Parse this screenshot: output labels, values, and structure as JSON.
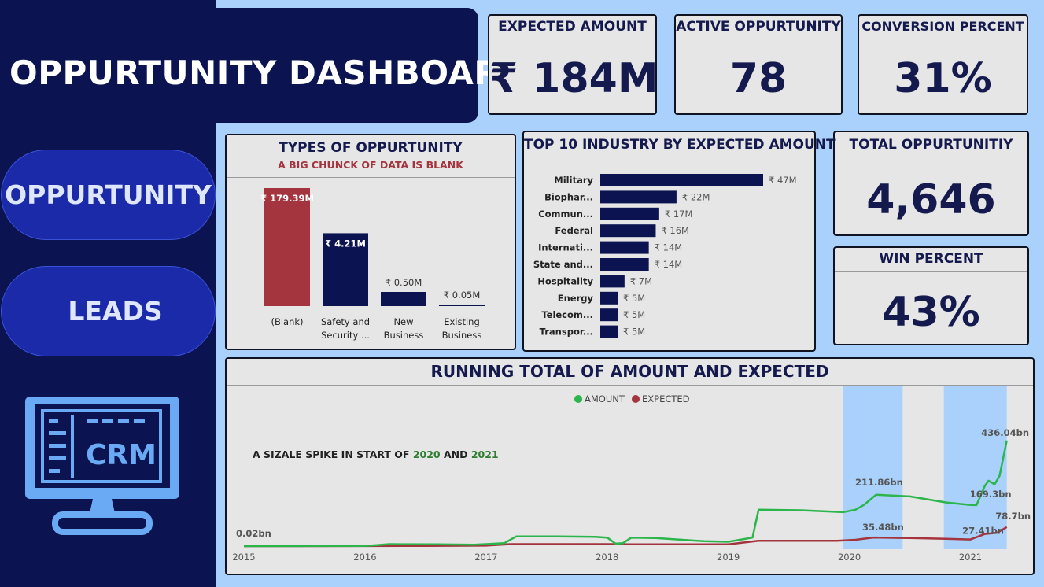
{
  "dashboard_title": "OPPURTUNITY DASHBOARD",
  "nav": {
    "oppurtunity": "OPPURTUNITY",
    "leads": "LEADS"
  },
  "crm_logo_text": "CRM",
  "kpis": {
    "expected_amount": {
      "label": "EXPECTED AMOUNT",
      "value": "₹ 184M"
    },
    "active_oppurtunity": {
      "label": "ACTIVE OPPURTUNITY",
      "value": "78"
    },
    "conversion_percent": {
      "label": "CONVERSION PERCENT",
      "value": "31%"
    },
    "total_oppurtunity": {
      "label": "TOTAL OPPURTUNITIY",
      "value": "4,646"
    },
    "win_percent": {
      "label": "WIN PERCENT",
      "value": "43%"
    }
  },
  "colors": {
    "navy": "#0b1350",
    "red": "#a4353f",
    "green": "#2bb54a",
    "highlight": "#a9d1fb"
  },
  "chart_data": [
    {
      "type": "bar",
      "title": "TYPES OF OPPURTUNITY",
      "subtitle": "A BIG CHUNCK OF DATA IS BLANK",
      "categories": [
        "(Blank)",
        "Safety and Security ...",
        "New Business",
        "Existing Business"
      ],
      "values": [
        179.39,
        4.21,
        0.5,
        0.05
      ],
      "value_labels": [
        "₹ 179.39M",
        "₹ 4.21M",
        "₹ 0.50M",
        "₹ 0.05M"
      ],
      "colors": [
        "#a4353f",
        "#0b1350",
        "#0b1350",
        "#0b1350"
      ]
    },
    {
      "type": "bar",
      "orientation": "horizontal",
      "title": "TOP 10 INDUSTRY BY EXPECTED AMOUNT",
      "categories": [
        "Military",
        "Biophar...",
        "Commun...",
        "Federal",
        "Internati...",
        "State and...",
        "Hospitality",
        "Energy",
        "Telecom...",
        "Transpor..."
      ],
      "values": [
        47,
        22,
        17,
        16,
        14,
        14,
        7,
        5,
        5,
        5
      ],
      "value_labels": [
        "₹ 47M",
        "₹ 22M",
        "₹ 17M",
        "₹ 16M",
        "₹ 14M",
        "₹ 14M",
        "₹ 7M",
        "₹ 5M",
        "₹ 5M",
        "₹ 5M"
      ]
    },
    {
      "type": "line",
      "title": "RUNNING TOTAL OF AMOUNT AND EXPECTED",
      "annotation": {
        "prefix": "A SIZALE SPIKE IN START OF ",
        "year1": "2020",
        "middle": " AND ",
        "year2": "2021"
      },
      "x_ticks": [
        "2015",
        "2016",
        "2017",
        "2018",
        "2019",
        "2020",
        "2021"
      ],
      "x_range": [
        2015,
        2021.38
      ],
      "y_range": [
        0,
        520
      ],
      "highlight_ranges": [
        [
          2019.95,
          2020.44
        ],
        [
          2020.78,
          2021.3
        ]
      ],
      "series": [
        {
          "name": "AMOUNT",
          "color": "#2bb54a",
          "points": [
            [
              2015,
              0.02
            ],
            [
              2016,
              0.5
            ],
            [
              2016.1,
              4
            ],
            [
              2016.2,
              8
            ],
            [
              2016.6,
              7
            ],
            [
              2016.9,
              6
            ],
            [
              2017.0,
              8
            ],
            [
              2017.15,
              12
            ],
            [
              2017.25,
              40
            ],
            [
              2017.6,
              40
            ],
            [
              2017.9,
              38
            ],
            [
              2018.0,
              35
            ],
            [
              2018.07,
              10
            ],
            [
              2018.13,
              12
            ],
            [
              2018.2,
              35
            ],
            [
              2018.4,
              33
            ],
            [
              2018.8,
              20
            ],
            [
              2019.0,
              18
            ],
            [
              2019.2,
              35
            ],
            [
              2019.25,
              150
            ],
            [
              2019.6,
              148
            ],
            [
              2019.95,
              140
            ],
            [
              2020.05,
              150
            ],
            [
              2020.12,
              170
            ],
            [
              2020.22,
              211.86
            ],
            [
              2020.5,
              205
            ],
            [
              2020.8,
              180
            ],
            [
              2021.0,
              170
            ],
            [
              2021.05,
              169.3
            ],
            [
              2021.12,
              250
            ],
            [
              2021.15,
              270
            ],
            [
              2021.2,
              255
            ],
            [
              2021.24,
              290
            ],
            [
              2021.3,
              436.04
            ]
          ]
        },
        {
          "name": "EXPECTED",
          "color": "#a4353f",
          "points": [
            [
              2015,
              0.02
            ],
            [
              2016,
              0.2
            ],
            [
              2016.5,
              1
            ],
            [
              2017,
              2
            ],
            [
              2017.2,
              8
            ],
            [
              2017.6,
              8
            ],
            [
              2018.0,
              8
            ],
            [
              2018.2,
              7
            ],
            [
              2018.6,
              7
            ],
            [
              2019.0,
              7
            ],
            [
              2019.25,
              22
            ],
            [
              2019.9,
              22
            ],
            [
              2020.05,
              26
            ],
            [
              2020.2,
              35.48
            ],
            [
              2020.5,
              33
            ],
            [
              2020.8,
              30
            ],
            [
              2021.0,
              27.41
            ],
            [
              2021.12,
              50
            ],
            [
              2021.22,
              55
            ],
            [
              2021.3,
              78.7
            ]
          ]
        }
      ],
      "data_labels": [
        {
          "series": "AMOUNT",
          "x": 2015,
          "y": 0.02,
          "text": "0.02bn"
        },
        {
          "series": "AMOUNT",
          "x": 2020.22,
          "y": 211.86,
          "text": "211.86bn"
        },
        {
          "series": "AMOUNT",
          "x": 2021.05,
          "y": 169.3,
          "text": "169.3bn"
        },
        {
          "series": "AMOUNT",
          "x": 2021.3,
          "y": 436.04,
          "text": "436.04bn"
        },
        {
          "series": "EXPECTED",
          "x": 2020.2,
          "y": 35.48,
          "text": "35.48bn"
        },
        {
          "series": "EXPECTED",
          "x": 2021.0,
          "y": 27.41,
          "text": "27.41bn"
        },
        {
          "series": "EXPECTED",
          "x": 2021.3,
          "y": 78.7,
          "text": "78.7bn"
        }
      ],
      "legend_position": "top-center"
    }
  ]
}
